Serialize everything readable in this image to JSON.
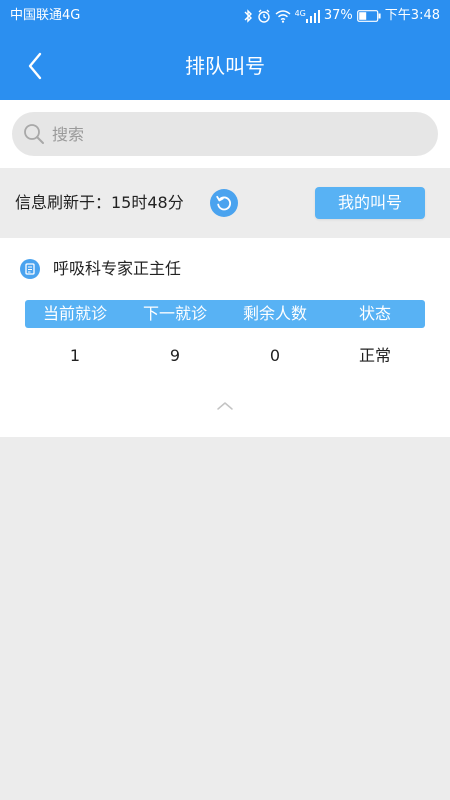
{
  "status_bar": {
    "carrier": "中国联通4G",
    "network_badge": "4G",
    "battery_percent": "37%",
    "time": "下午3:48",
    "icons": [
      "bluetooth-icon",
      "alarm-icon",
      "wifi-icon",
      "signal-icon",
      "battery-icon"
    ]
  },
  "nav": {
    "back_icon": "chevron-left-icon",
    "title": "排队叫号"
  },
  "search": {
    "placeholder": "搜索",
    "value": ""
  },
  "refresh": {
    "label": "信息刷新于：15时48分",
    "icon": "refresh-icon",
    "my_number_label": "我的叫号"
  },
  "queue": {
    "department": "呼吸科专家正主任",
    "dept_icon": "document-icon",
    "columns": [
      "当前就诊",
      "下一就诊",
      "剩余人数",
      "状态"
    ],
    "row": [
      "1",
      "9",
      "0",
      "正常"
    ],
    "collapse_icon": "chevron-up-icon"
  },
  "colors": {
    "header_bg": "#2b8ff0",
    "accent": "#58b2f4",
    "page_bg": "#ececec"
  }
}
